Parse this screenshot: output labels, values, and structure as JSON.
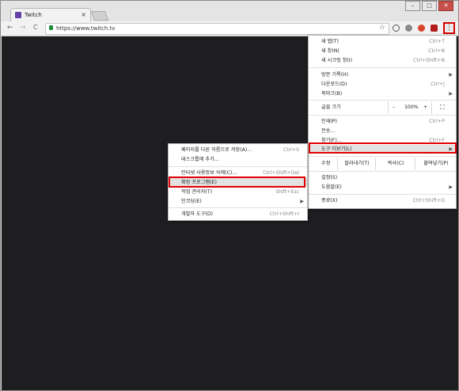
{
  "tab": {
    "title": "Twitch",
    "close": "×"
  },
  "window": {
    "minimize": "–",
    "maximize": "□",
    "close": "✕"
  },
  "toolbar": {
    "back": "←",
    "forward": "→",
    "reload": "C",
    "url": "https://www.twitch.tv",
    "star": "☆",
    "menu": "⋮"
  },
  "main_menu": {
    "new_tab": {
      "label": "새 탭(T)",
      "shortcut": "Ctrl+T"
    },
    "new_window": {
      "label": "새 창(N)",
      "shortcut": "Ctrl+N"
    },
    "new_incognito": {
      "label": "새 시크릿 창(I)",
      "shortcut": "Ctrl+Shift+N"
    },
    "history": {
      "label": "방문 기록(H)"
    },
    "downloads": {
      "label": "다운로드(D)",
      "shortcut": "Ctrl+J"
    },
    "bookmarks": {
      "label": "북마크(B)"
    },
    "zoom": {
      "label": "글꼴 크기",
      "minus": "–",
      "value": "100%",
      "plus": "+",
      "fullscreen": "⛶"
    },
    "print": {
      "label": "인쇄(P)",
      "shortcut": "Ctrl+P"
    },
    "cast": {
      "label": "전송..."
    },
    "find": {
      "label": "찾기(F)...",
      "shortcut": "Ctrl+F"
    },
    "more_tools": {
      "label": "도구 더보기(L)"
    },
    "edit": {
      "label": "수정",
      "cut": "잘라내기(T)",
      "copy": "복사(C)",
      "paste": "붙여넣기(P)"
    },
    "settings": {
      "label": "설정(S)"
    },
    "help": {
      "label": "도움말(E)"
    },
    "exit": {
      "label": "종료(X)",
      "shortcut": "Ctrl+Shift+Q"
    }
  },
  "submenu": {
    "save_page": {
      "label": "페이지를 다른 이름으로 저장(A)...",
      "shortcut": "Ctrl+S"
    },
    "add_to_desktop": {
      "label": "데스크톱에 추가..."
    },
    "clear_data": {
      "label": "인터넷 사용정보 삭제(C)...",
      "shortcut": "Ctrl+Shift+Del"
    },
    "extensions": {
      "label": "확장 프로그램(E)"
    },
    "task_manager": {
      "label": "작업 관리자(T)",
      "shortcut": "Shift+Esc"
    },
    "encoding": {
      "label": "인코딩(E)"
    },
    "dev_tools": {
      "label": "개발자 도구(D)",
      "shortcut": "Ctrl+Shift+I"
    }
  },
  "colors": {
    "highlight": "#e00000",
    "page_bg": "#1e1d20",
    "twitch": "#6441a4"
  }
}
